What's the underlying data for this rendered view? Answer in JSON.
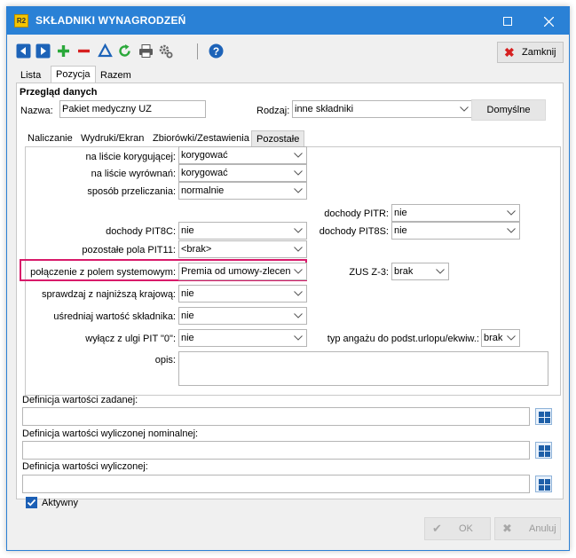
{
  "window": {
    "title": "SKŁADNIKI WYNAGRODZEŃ",
    "logo": "R2"
  },
  "toolbar": {
    "icons": [
      "nav-left-icon",
      "nav-right-icon",
      "add-icon",
      "remove-icon",
      "triangle-icon",
      "refresh-icon",
      "print-icon",
      "settings-icon",
      "help-icon"
    ],
    "close_label": "Zamknij"
  },
  "main_tabs": [
    "Lista",
    "Pozycja",
    "Razem"
  ],
  "section": {
    "title": "Przegląd danych"
  },
  "header": {
    "name_label": "Nazwa:",
    "name_value": "Pakiet medyczny UZ",
    "kind_label": "Rodzaj:",
    "kind_value": "inne składniki",
    "default_label": "Domyślne"
  },
  "sub_tabs": [
    "Naliczanie",
    "Wydruki/Ekran",
    "Zbiorówki/Zestawienia",
    "Pozostałe"
  ],
  "fields": {
    "na_liscie_kor": {
      "label": "na liście korygującej:",
      "value": "korygować"
    },
    "na_liscie_wyr": {
      "label": "na liście wyrównań:",
      "value": "korygować"
    },
    "sposob": {
      "label": "sposób przeliczania:",
      "value": "normalnie"
    },
    "pitr": {
      "label": "dochody PITR:",
      "value": "nie"
    },
    "pit8c": {
      "label": "dochody PIT8C:",
      "value": "nie"
    },
    "pit8s": {
      "label": "dochody PIT8S:",
      "value": "nie"
    },
    "pit11": {
      "label": "pozostałe pola PIT11:",
      "value": "<brak>"
    },
    "polaczenie": {
      "label": "połączenie z polem systemowym:",
      "value": "Premia od umowy-zlecenia"
    },
    "zus": {
      "label": "ZUS Z-3:",
      "value": "brak"
    },
    "najnizsza": {
      "label": "sprawdzaj z najniższą krajową:",
      "value": "nie"
    },
    "usredniaj": {
      "label": "uśredniaj wartość składnika:",
      "value": "nie"
    },
    "ulga": {
      "label": "wyłącz z ulgi PIT \"0\":",
      "value": "nie"
    },
    "typ_angazu": {
      "label": "typ angażu do podst.urlopu/ekwiw.:",
      "value": "brak"
    },
    "opis": {
      "label": "opis:",
      "value": ""
    }
  },
  "definitions": [
    {
      "label": "Definicja wartości zadanej:",
      "value": ""
    },
    {
      "label": "Definicja wartości wyliczonej nominalnej:",
      "value": ""
    },
    {
      "label": "Definicja wartości wyliczonej:",
      "value": ""
    }
  ],
  "active": {
    "label": "Aktywny",
    "checked": true
  },
  "footer": {
    "ok_label": "OK",
    "cancel_label": "Anuluj"
  }
}
